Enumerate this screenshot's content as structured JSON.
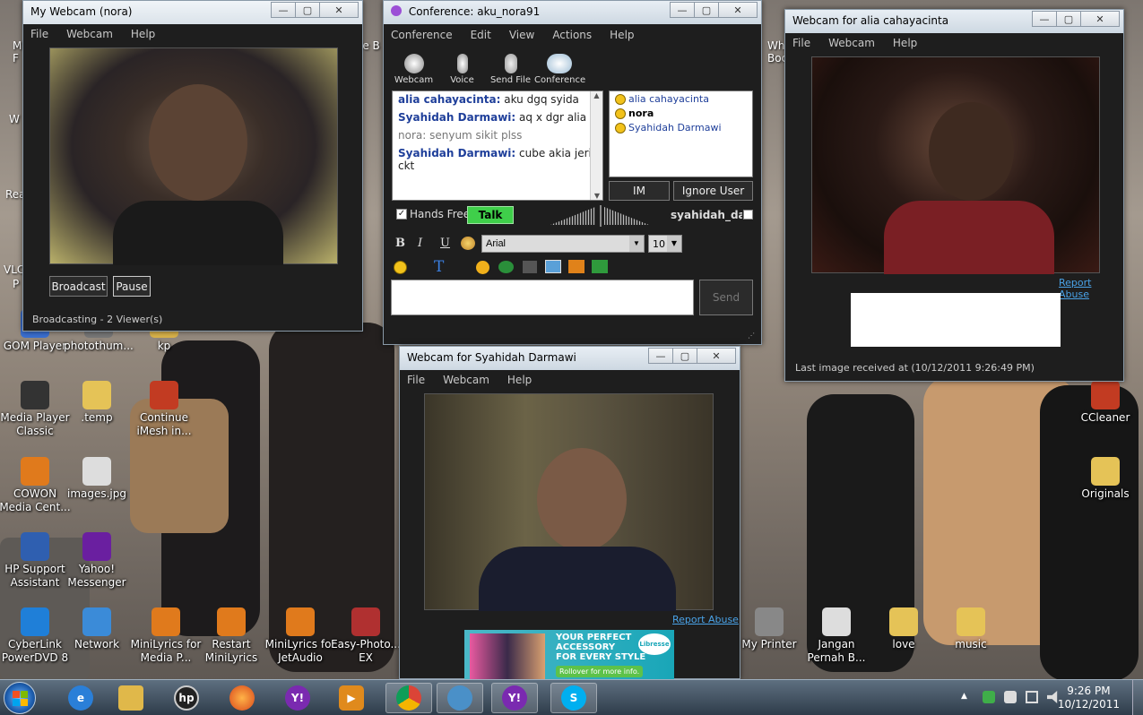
{
  "desktop_icons": [
    {
      "label": "GOM Player",
      "icon": "gom-icon",
      "color": "#3a6fd1"
    },
    {
      "label": "photothum...",
      "icon": "image-icon",
      "color": "#777"
    },
    {
      "label": "kp",
      "icon": "folder-icon",
      "color": "#d9b24a"
    },
    {
      "label": "Media Player Classic",
      "icon": "film-icon",
      "color": "#333"
    },
    {
      "label": ".temp",
      "icon": "folder-icon",
      "color": "#e5c357"
    },
    {
      "label": "Continue iMesh in...",
      "icon": "imesh-icon",
      "color": "#c23b22"
    },
    {
      "label": "COWON Media Cent...",
      "icon": "cowon-icon",
      "color": "#e07a1c"
    },
    {
      "label": "images.jpg",
      "icon": "image-icon",
      "color": "#ddd"
    },
    {
      "label": "HP Support Assistant",
      "icon": "hp-icon",
      "color": "#2f5fb0"
    },
    {
      "label": "Yahoo! Messenger",
      "icon": "yahoo-icon",
      "color": "#6a1fa0"
    },
    {
      "label": "CyberLink PowerDVD 8",
      "icon": "dvd-icon",
      "color": "#1f7fd8"
    },
    {
      "label": "Network",
      "icon": "network-icon",
      "color": "#3b8bd8"
    },
    {
      "label": "MiniLyrics for Media P...",
      "icon": "lyrics-icon",
      "color": "#e07a1c"
    },
    {
      "label": "Restart MiniLyrics",
      "icon": "lyrics-icon",
      "color": "#e07a1c"
    },
    {
      "label": "MiniLyrics for JetAudio",
      "icon": "lyrics-icon",
      "color": "#e07a1c"
    },
    {
      "label": "Easy-Photo... EX",
      "icon": "photo-icon",
      "color": "#b03030"
    },
    {
      "label": "My Printer",
      "icon": "printer-icon",
      "color": "#888"
    },
    {
      "label": "Jangan Pernah B...",
      "icon": "video-file-icon",
      "color": "#ddd"
    },
    {
      "label": "love",
      "icon": "folder-icon",
      "color": "#e5c357"
    },
    {
      "label": "music",
      "icon": "folder-icon",
      "color": "#e5c357"
    },
    {
      "label": "CCleaner",
      "icon": "ccleaner-icon",
      "color": "#c23b22"
    },
    {
      "label": "Originals",
      "icon": "folder-icon",
      "color": "#e5c357"
    }
  ],
  "partial_icons": [
    {
      "label": "M",
      "icon": "partial-icon"
    },
    {
      "label": "F",
      "icon": "partial-icon"
    },
    {
      "label": "W",
      "icon": "partial-icon"
    },
    {
      "label": "Rea",
      "icon": "partial-icon"
    },
    {
      "label": "VLC",
      "icon": "partial-icon"
    },
    {
      "label": "P",
      "icon": "partial-icon"
    },
    {
      "label": "le B",
      "icon": "partial-icon"
    },
    {
      "label": "Wh",
      "icon": "partial-icon"
    },
    {
      "label": "Boc",
      "icon": "partial-icon"
    }
  ],
  "mywebcam": {
    "title": "My Webcam (nora)",
    "menu": [
      "File",
      "Webcam",
      "Help"
    ],
    "broadcast_label": "Broadcast",
    "pause_label": "Pause",
    "status": "Broadcasting - 2 Viewer(s)"
  },
  "conference": {
    "title": "Conference:  aku_nora91",
    "menu": [
      "Conference",
      "Edit",
      "View",
      "Actions",
      "Help"
    ],
    "tools": [
      "Webcam",
      "Voice",
      "Send File",
      "Conference"
    ],
    "messages": [
      {
        "who": "alia cahayacinta:",
        "text": "aku dgq syida",
        "me": false
      },
      {
        "who": "Syahidah Darmawi:",
        "text": "aq x dgr alia",
        "me": false
      },
      {
        "who": "nora:",
        "text": "senyum sikit plss",
        "me": true
      },
      {
        "who": "Syahidah Darmawi:",
        "text": "cube akia jerit ckt",
        "me": false
      }
    ],
    "users": [
      {
        "name": "alia cahayacinta",
        "bold": false
      },
      {
        "name": "nora",
        "bold": true
      },
      {
        "name": "Syahidah Darmawi",
        "bold": false
      }
    ],
    "im_label": "IM",
    "ignore_label": "Ignore User",
    "handsfree_label": "Hands Free",
    "talk_label": "Talk",
    "speaker_label": "syahidah_dan",
    "font_name": "Arial",
    "font_size": "10",
    "send_label": "Send"
  },
  "syahidah": {
    "title": "Webcam for Syahidah Darmawi",
    "menu": [
      "File",
      "Webcam",
      "Help"
    ],
    "report": "Report Abuse",
    "ad_line1": "YOUR PERFECT",
    "ad_line2": "ACCESSORY",
    "ad_line3": "FOR EVERY STYLE",
    "ad_cta": "Rollover for more info.",
    "ad_brand": "Libresse"
  },
  "alia": {
    "title": "Webcam for alia cahayacinta",
    "menu": [
      "File",
      "Webcam",
      "Help"
    ],
    "report": "Report Abuse",
    "status": "Last image received at (10/12/2011 9:26:49 PM)"
  },
  "taskbar": {
    "time": "9:26 PM",
    "date": "10/12/2011"
  },
  "colors": {
    "talk_green": "#3fcf4a",
    "link_blue": "#4aa3e8",
    "chat_name": "#1f3f9a"
  }
}
